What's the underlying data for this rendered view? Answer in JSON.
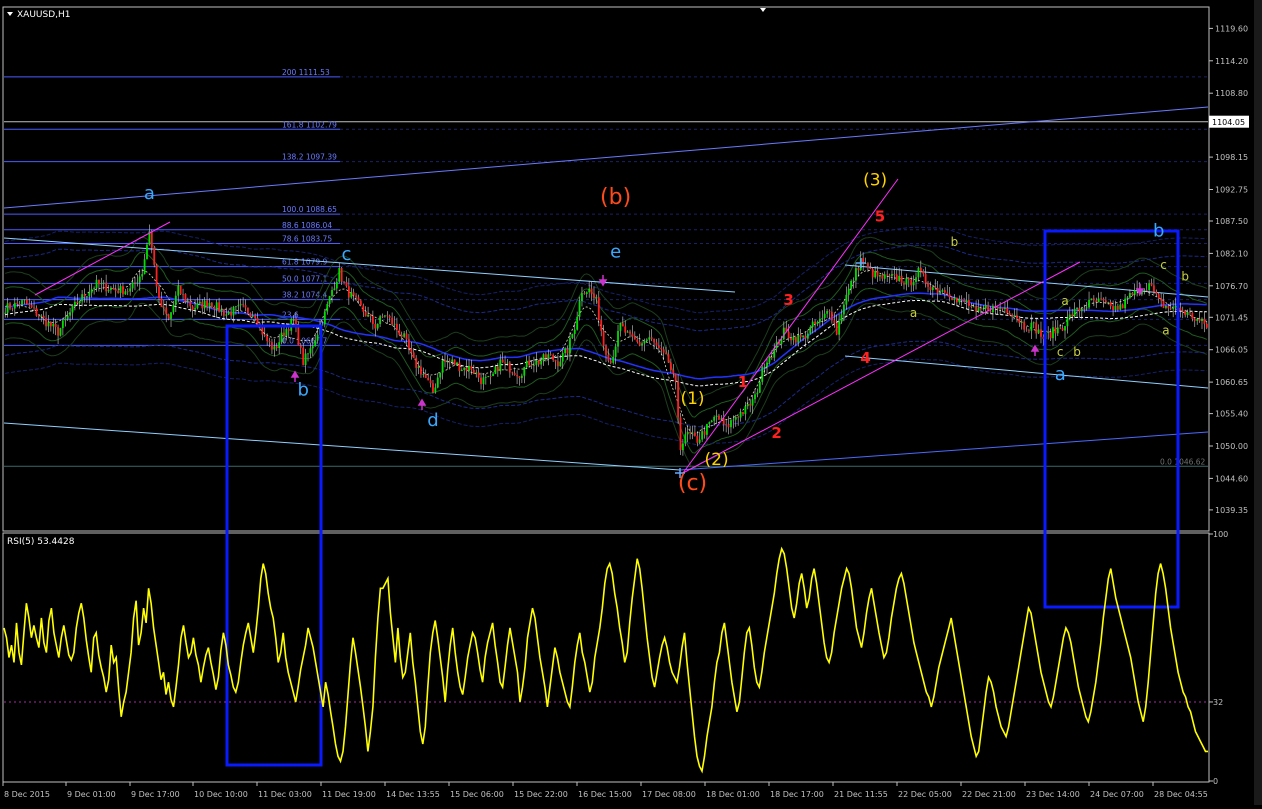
{
  "window": {
    "title": "XAUUSD,H1"
  },
  "colors": {
    "background": "#000000",
    "grid": "#2e3440",
    "axis": "#c0c0c0",
    "candle_up": "#00e000",
    "candle_down": "#ff2020",
    "wick": "#d0d0d0",
    "fib": "#4a5cff",
    "channel": "#8fd0ff",
    "wave_line": "#ff30ff",
    "box": "#0a1aff",
    "rsi": "#ffff00",
    "wave_blue": "#3aa8ff",
    "wave_orange": "#ff4a1a",
    "wave_yellow": "#ffd200",
    "wave_red": "#ff2020",
    "wave_green": "#c8d040",
    "arrow": "#cc33cc"
  },
  "chart_data": [
    {
      "type": "candlestick",
      "title": "XAUUSD,H1",
      "ylim": [
        1036.0,
        1123.0
      ],
      "y_ticks": [
        "1119.60",
        "1114.20",
        "1108.80",
        "1104.05",
        "1098.15",
        "1092.75",
        "1087.50",
        "1082.10",
        "1076.70",
        "1071.45",
        "1066.05",
        "1060.65",
        "1055.40",
        "1050.00",
        "1044.60",
        "1039.35"
      ],
      "current_price": "1104.05",
      "x_tick_labels": [
        "8 Dec 2015",
        "9 Dec 01:00",
        "9 Dec 17:00",
        "10 Dec 10:00",
        "11 Dec 03:00",
        "11 Dec 19:00",
        "14 Dec 13:55",
        "15 Dec 06:00",
        "15 Dec 22:00",
        "16 Dec 15:00",
        "17 Dec 08:00",
        "18 Dec 01:00",
        "18 Dec 17:00",
        "21 Dec 11:55",
        "22 Dec 05:00",
        "22 Dec 21:00",
        "23 Dec 14:00",
        "24 Dec 07:00",
        "28 Dec 04:55"
      ],
      "price_path_keypoints": [
        [
          0,
          1073
        ],
        [
          8,
          1074
        ],
        [
          16,
          1071
        ],
        [
          22,
          1069
        ],
        [
          30,
          1074
        ],
        [
          38,
          1077
        ],
        [
          46,
          1076
        ],
        [
          52,
          1076
        ],
        [
          57,
          1079
        ],
        [
          60,
          1086
        ],
        [
          64,
          1074
        ],
        [
          68,
          1071
        ],
        [
          72,
          1076
        ],
        [
          78,
          1073
        ],
        [
          85,
          1074
        ],
        [
          92,
          1072
        ],
        [
          98,
          1073
        ],
        [
          104,
          1072
        ],
        [
          108,
          1068
        ],
        [
          112,
          1066
        ],
        [
          116,
          1069
        ],
        [
          120,
          1071
        ],
        [
          124,
          1064
        ],
        [
          127,
          1066
        ],
        [
          130,
          1069
        ],
        [
          133,
          1072
        ],
        [
          136,
          1076
        ],
        [
          139,
          1079
        ],
        [
          142,
          1076
        ],
        [
          146,
          1074
        ],
        [
          150,
          1072
        ],
        [
          154,
          1070
        ],
        [
          158,
          1072
        ],
        [
          162,
          1070
        ],
        [
          166,
          1068
        ],
        [
          170,
          1064
        ],
        [
          174,
          1062
        ],
        [
          178,
          1059
        ],
        [
          182,
          1064
        ],
        [
          186,
          1064
        ],
        [
          190,
          1063
        ],
        [
          194,
          1063
        ],
        [
          198,
          1061
        ],
        [
          202,
          1061
        ],
        [
          206,
          1064
        ],
        [
          210,
          1063
        ],
        [
          214,
          1062
        ],
        [
          218,
          1064
        ],
        [
          222,
          1064
        ],
        [
          226,
          1065
        ],
        [
          230,
          1064
        ],
        [
          234,
          1066
        ],
        [
          237,
          1070
        ],
        [
          240,
          1076
        ],
        [
          243,
          1076
        ],
        [
          246,
          1074
        ],
        [
          249,
          1067
        ],
        [
          252,
          1064
        ],
        [
          256,
          1070
        ],
        [
          260,
          1068
        ],
        [
          264,
          1067
        ],
        [
          268,
          1068
        ],
        [
          272,
          1066
        ],
        [
          276,
          1064
        ],
        [
          279,
          1060
        ],
        [
          281,
          1050
        ],
        [
          284,
          1052
        ],
        [
          288,
          1051
        ],
        [
          292,
          1053
        ],
        [
          296,
          1055
        ],
        [
          300,
          1053
        ],
        [
          304,
          1055
        ],
        [
          308,
          1056
        ],
        [
          312,
          1058
        ],
        [
          316,
          1064
        ],
        [
          320,
          1066
        ],
        [
          324,
          1069
        ],
        [
          328,
          1068
        ],
        [
          332,
          1068
        ],
        [
          336,
          1070
        ],
        [
          340,
          1071
        ],
        [
          343,
          1073
        ],
        [
          346,
          1069
        ],
        [
          349,
          1074
        ],
        [
          352,
          1077
        ],
        [
          356,
          1081
        ],
        [
          360,
          1079
        ],
        [
          364,
          1078
        ],
        [
          368,
          1078
        ],
        [
          372,
          1078
        ],
        [
          376,
          1077
        ],
        [
          380,
          1079
        ],
        [
          384,
          1077
        ],
        [
          388,
          1076
        ],
        [
          392,
          1076
        ],
        [
          396,
          1074
        ],
        [
          400,
          1074
        ],
        [
          404,
          1072
        ],
        [
          408,
          1073
        ],
        [
          412,
          1073
        ],
        [
          416,
          1073
        ],
        [
          420,
          1072
        ],
        [
          424,
          1070
        ],
        [
          428,
          1070
        ],
        [
          432,
          1068
        ],
        [
          436,
          1069
        ],
        [
          440,
          1070
        ],
        [
          444,
          1072
        ],
        [
          448,
          1073
        ],
        [
          452,
          1074
        ],
        [
          456,
          1074
        ],
        [
          460,
          1073
        ],
        [
          464,
          1073
        ],
        [
          468,
          1075
        ],
        [
          472,
          1076
        ],
        [
          476,
          1077
        ],
        [
          480,
          1074
        ],
        [
          484,
          1073
        ],
        [
          488,
          1073
        ],
        [
          492,
          1072
        ],
        [
          496,
          1071
        ],
        [
          500,
          1070
        ]
      ],
      "fibonacci_levels": [
        {
          "label": "200 1111.53",
          "value": 1111.53
        },
        {
          "label": "161.8 1102.79",
          "value": 1102.79
        },
        {
          "label": "138.2 1097.39",
          "value": 1097.39
        },
        {
          "label": "100.0 1088.65",
          "value": 1088.65
        },
        {
          "label": "88.6 1086.04",
          "value": 1086.04
        },
        {
          "label": "78.6 1083.75",
          "value": 1083.75
        },
        {
          "label": "61.8 1079.9",
          "value": 1079.9
        },
        {
          "label": "50.0 1077.1",
          "value": 1077.1
        },
        {
          "label": "38.2 1074.4",
          "value": 1074.4
        },
        {
          "label": "23.6",
          "value": 1071.1
        },
        {
          "label": "0.0 1066.77",
          "value": 1066.77
        },
        {
          "label": "0.0 1046.62",
          "value": 1046.62
        }
      ],
      "annotations": [
        {
          "text": "a",
          "color": "wave_blue",
          "bar": 60,
          "price": 1091.2
        },
        {
          "text": "b",
          "color": "wave_blue",
          "bar": 124,
          "price": 1058.4
        },
        {
          "text": "c",
          "color": "wave_blue",
          "bar": 142,
          "price": 1081.0
        },
        {
          "text": "d",
          "color": "wave_blue",
          "bar": 178,
          "price": 1053.3
        },
        {
          "text": "e",
          "color": "wave_blue",
          "bar": 254,
          "price": 1081.4
        },
        {
          "text": "(b)",
          "color": "wave_orange",
          "bar": 254,
          "price": 1090.3
        },
        {
          "text": "(c)",
          "color": "wave_orange",
          "bar": 286,
          "price": 1042.7
        },
        {
          "text": "(1)",
          "color": "wave_yellow",
          "bar": 286,
          "price": 1057.0
        },
        {
          "text": "(2)",
          "color": "wave_yellow",
          "bar": 296,
          "price": 1046.8
        },
        {
          "text": "(3)",
          "color": "wave_yellow",
          "bar": 362,
          "price": 1093.4
        },
        {
          "text": "1",
          "color": "wave_red",
          "bar": 307,
          "price": 1059.8
        },
        {
          "text": "2",
          "color": "wave_red",
          "bar": 321,
          "price": 1051.3
        },
        {
          "text": "3",
          "color": "wave_red",
          "bar": 326,
          "price": 1073.5
        },
        {
          "text": "4",
          "color": "wave_red",
          "bar": 358,
          "price": 1063.8
        },
        {
          "text": "5",
          "color": "wave_red",
          "bar": 364,
          "price": 1087.4
        },
        {
          "text": "b",
          "color": "wave_blue",
          "bar": 480,
          "price": 1084.9
        },
        {
          "text": "a",
          "color": "wave_blue",
          "bar": 439,
          "price": 1061.0
        },
        {
          "text": "a",
          "color": "wave_green",
          "bar": 378,
          "price": 1071.5
        },
        {
          "text": "b",
          "color": "wave_green",
          "bar": 395,
          "price": 1083.3
        },
        {
          "text": "a",
          "color": "wave_green",
          "bar": 441,
          "price": 1073.5
        },
        {
          "text": "c",
          "color": "wave_green",
          "bar": 482,
          "price": 1079.5
        },
        {
          "text": "b",
          "color": "wave_green",
          "bar": 491,
          "price": 1077.6
        },
        {
          "text": "a",
          "color": "wave_green",
          "bar": 483,
          "price": 1068.6
        },
        {
          "text": "c",
          "color": "wave_green",
          "bar": 439,
          "price": 1065.0
        },
        {
          "text": "b",
          "color": "wave_green",
          "bar": 446,
          "price": 1065.0
        }
      ]
    },
    {
      "type": "line",
      "title": "RSI(5) 53.4428",
      "ylim": [
        0,
        100
      ],
      "y_ticks": [
        "100",
        "32",
        "0"
      ],
      "reference_level": 32,
      "values": [
        62,
        58,
        50,
        55,
        48,
        64,
        52,
        47,
        60,
        72,
        66,
        58,
        63,
        58,
        54,
        66,
        56,
        52,
        65,
        70,
        60,
        55,
        50,
        58,
        63,
        57,
        51,
        49,
        52,
        62,
        68,
        72,
        66,
        57,
        50,
        44,
        58,
        60,
        51,
        46,
        42,
        36,
        41,
        55,
        48,
        50,
        37,
        26,
        32,
        36,
        44,
        52,
        66,
        73,
        55,
        60,
        70,
        64,
        78,
        72,
        62,
        55,
        48,
        41,
        44,
        35,
        40,
        33,
        30,
        38,
        47,
        58,
        63,
        56,
        50,
        52,
        58,
        51,
        47,
        40,
        46,
        51,
        54,
        48,
        43,
        37,
        42,
        53,
        60,
        55,
        47,
        43,
        38,
        36,
        40,
        48,
        55,
        60,
        64,
        58,
        52,
        60,
        70,
        82,
        88,
        84,
        76,
        70,
        66,
        58,
        48,
        52,
        60,
        50,
        44,
        40,
        36,
        32,
        38,
        45,
        50,
        55,
        62,
        58,
        54,
        48,
        42,
        36,
        30,
        40,
        35,
        28,
        22,
        15,
        10,
        8,
        12,
        22,
        35,
        48,
        58,
        52,
        45,
        38,
        30,
        22,
        12,
        20,
        30,
        50,
        66,
        78,
        78,
        80,
        82,
        68,
        58,
        48,
        62,
        50,
        42,
        44,
        52,
        60,
        48,
        40,
        30,
        20,
        15,
        22,
        38,
        52,
        60,
        65,
        58,
        50,
        42,
        32,
        45,
        55,
        62,
        52,
        44,
        38,
        35,
        42,
        50,
        55,
        60,
        58,
        52,
        45,
        40,
        50,
        56,
        60,
        64,
        55,
        48,
        40,
        38,
        46,
        55,
        62,
        56,
        50,
        44,
        32,
        38,
        46,
        58,
        64,
        70,
        66,
        58,
        50,
        44,
        38,
        30,
        38,
        46,
        54,
        50,
        44,
        40,
        36,
        32,
        30,
        38,
        48,
        55,
        60,
        52,
        48,
        42,
        36,
        40,
        50,
        56,
        62,
        70,
        80,
        86,
        88,
        84,
        76,
        70,
        62,
        56,
        48,
        52,
        64,
        74,
        82,
        90,
        86,
        78,
        68,
        58,
        50,
        42,
        38,
        44,
        50,
        55,
        58,
        54,
        48,
        44,
        42,
        40,
        46,
        54,
        60,
        48,
        38,
        28,
        18,
        10,
        6,
        4,
        10,
        18,
        24,
        30,
        40,
        48,
        52,
        60,
        64,
        56,
        48,
        40,
        34,
        28,
        32,
        42,
        52,
        60,
        62,
        55,
        46,
        40,
        38,
        44,
        52,
        58,
        64,
        70,
        76,
        84,
        90,
        94,
        92,
        86,
        78,
        70,
        66,
        72,
        80,
        84,
        78,
        70,
        74,
        82,
        86,
        80,
        72,
        64,
        56,
        50,
        48,
        52,
        60,
        66,
        72,
        78,
        82,
        86,
        84,
        78,
        70,
        62,
        58,
        54,
        60,
        68,
        74,
        78,
        72,
        66,
        60,
        55,
        50,
        52,
        58,
        66,
        72,
        78,
        82,
        84,
        80,
        74,
        68,
        62,
        56,
        52,
        48,
        44,
        40,
        36,
        34,
        30,
        34,
        40,
        46,
        50,
        54,
        58,
        62,
        66,
        60,
        54,
        48,
        42,
        36,
        30,
        24,
        18,
        14,
        10,
        12,
        20,
        28,
        36,
        42,
        40,
        36,
        30,
        26,
        22,
        20,
        18,
        22,
        28,
        34,
        40,
        46,
        52,
        58,
        64,
        70,
        68,
        62,
        56,
        50,
        44,
        40,
        36,
        32,
        30,
        34,
        40,
        46,
        52,
        58,
        62,
        60,
        56,
        50,
        44,
        38,
        34,
        30,
        26,
        24,
        28,
        34,
        40,
        48,
        56,
        66,
        74,
        82,
        86,
        80,
        74,
        70,
        66,
        62,
        58,
        54,
        50,
        44,
        38,
        32,
        28,
        24,
        30,
        40,
        52,
        64,
        76,
        84,
        88,
        84,
        78,
        70,
        62,
        56,
        50,
        44,
        40,
        36,
        34,
        30,
        28,
        24,
        20,
        18,
        16,
        14,
        12,
        12
      ]
    }
  ],
  "bottom_axis": {
    "labels_ref": "chart_data.0.x_tick_labels"
  }
}
